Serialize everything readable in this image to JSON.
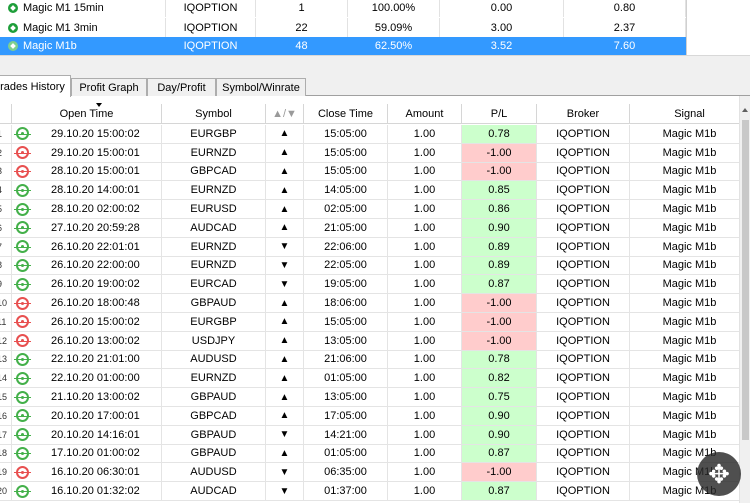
{
  "strategies": [
    {
      "name": "Magic M1 15min",
      "broker": "IQOPTION",
      "trades": "1",
      "winrate": "100.00%",
      "profit": "0.00",
      "extra": "0.80",
      "selected": false
    },
    {
      "name": "Magic M1 3min",
      "broker": "IQOPTION",
      "trades": "22",
      "winrate": "59.09%",
      "profit": "3.00",
      "extra": "2.37",
      "selected": false
    },
    {
      "name": "Magic M1b",
      "broker": "IQOPTION",
      "trades": "48",
      "winrate": "62.50%",
      "profit": "3.52",
      "extra": "7.60",
      "selected": true
    }
  ],
  "tabs": [
    "rades History",
    "Profit Graph",
    "Day/Profit",
    "Symbol/Winrate"
  ],
  "active_tab": 0,
  "columns": {
    "open_time": "Open Time",
    "symbol": "Symbol",
    "dir": "▲/▼",
    "close_time": "Close Time",
    "amount": "Amount",
    "pl": "P/L",
    "broker": "Broker",
    "signal": "Signal"
  },
  "colors": {
    "win": "#ccffcc",
    "loss": "#ffcccc",
    "selected_row": "#3399ff",
    "icon_win": "#44b04a",
    "icon_loss": "#e85050"
  },
  "trades": [
    {
      "idx": "1",
      "open_time": "29.10.20 15:00:02",
      "symbol": "EURGBP",
      "dir": "▲",
      "close_time": "15:05:00",
      "amount": "1.00",
      "pl": "0.78",
      "result": "win",
      "broker": "IQOPTION",
      "signal": "Magic M1b"
    },
    {
      "idx": "2",
      "open_time": "29.10.20 15:00:01",
      "symbol": "EURNZD",
      "dir": "▲",
      "close_time": "15:05:00",
      "amount": "1.00",
      "pl": "-1.00",
      "result": "loss",
      "broker": "IQOPTION",
      "signal": "Magic M1b"
    },
    {
      "idx": "3",
      "open_time": "28.10.20 15:00:01",
      "symbol": "GBPCAD",
      "dir": "▲",
      "close_time": "15:05:00",
      "amount": "1.00",
      "pl": "-1.00",
      "result": "loss",
      "broker": "IQOPTION",
      "signal": "Magic M1b"
    },
    {
      "idx": "4",
      "open_time": "28.10.20 14:00:01",
      "symbol": "EURNZD",
      "dir": "▲",
      "close_time": "14:05:00",
      "amount": "1.00",
      "pl": "0.85",
      "result": "win",
      "broker": "IQOPTION",
      "signal": "Magic M1b"
    },
    {
      "idx": "5",
      "open_time": "28.10.20 02:00:02",
      "symbol": "EURUSD",
      "dir": "▲",
      "close_time": "02:05:00",
      "amount": "1.00",
      "pl": "0.86",
      "result": "win",
      "broker": "IQOPTION",
      "signal": "Magic M1b"
    },
    {
      "idx": "6",
      "open_time": "27.10.20 20:59:28",
      "symbol": "AUDCAD",
      "dir": "▲",
      "close_time": "21:05:00",
      "amount": "1.00",
      "pl": "0.90",
      "result": "win",
      "broker": "IQOPTION",
      "signal": "Magic M1b"
    },
    {
      "idx": "7",
      "open_time": "26.10.20 22:01:01",
      "symbol": "EURNZD",
      "dir": "▼",
      "close_time": "22:06:00",
      "amount": "1.00",
      "pl": "0.89",
      "result": "win",
      "broker": "IQOPTION",
      "signal": "Magic M1b"
    },
    {
      "idx": "8",
      "open_time": "26.10.20 22:00:00",
      "symbol": "EURNZD",
      "dir": "▼",
      "close_time": "22:05:00",
      "amount": "1.00",
      "pl": "0.89",
      "result": "win",
      "broker": "IQOPTION",
      "signal": "Magic M1b"
    },
    {
      "idx": "9",
      "open_time": "26.10.20 19:00:02",
      "symbol": "EURCAD",
      "dir": "▼",
      "close_time": "19:05:00",
      "amount": "1.00",
      "pl": "0.87",
      "result": "win",
      "broker": "IQOPTION",
      "signal": "Magic M1b"
    },
    {
      "idx": "10",
      "open_time": "26.10.20 18:00:48",
      "symbol": "GBPAUD",
      "dir": "▲",
      "close_time": "18:06:00",
      "amount": "1.00",
      "pl": "-1.00",
      "result": "loss",
      "broker": "IQOPTION",
      "signal": "Magic M1b"
    },
    {
      "idx": "11",
      "open_time": "26.10.20 15:00:02",
      "symbol": "EURGBP",
      "dir": "▲",
      "close_time": "15:05:00",
      "amount": "1.00",
      "pl": "-1.00",
      "result": "loss",
      "broker": "IQOPTION",
      "signal": "Magic M1b"
    },
    {
      "idx": "12",
      "open_time": "26.10.20 13:00:02",
      "symbol": "USDJPY",
      "dir": "▲",
      "close_time": "13:05:00",
      "amount": "1.00",
      "pl": "-1.00",
      "result": "loss",
      "broker": "IQOPTION",
      "signal": "Magic M1b"
    },
    {
      "idx": "13",
      "open_time": "22.10.20 21:01:00",
      "symbol": "AUDUSD",
      "dir": "▲",
      "close_time": "21:06:00",
      "amount": "1.00",
      "pl": "0.78",
      "result": "win",
      "broker": "IQOPTION",
      "signal": "Magic M1b"
    },
    {
      "idx": "14",
      "open_time": "22.10.20 01:00:00",
      "symbol": "EURNZD",
      "dir": "▲",
      "close_time": "01:05:00",
      "amount": "1.00",
      "pl": "0.82",
      "result": "win",
      "broker": "IQOPTION",
      "signal": "Magic M1b"
    },
    {
      "idx": "15",
      "open_time": "21.10.20 13:00:02",
      "symbol": "GBPAUD",
      "dir": "▲",
      "close_time": "13:05:00",
      "amount": "1.00",
      "pl": "0.75",
      "result": "win",
      "broker": "IQOPTION",
      "signal": "Magic M1b"
    },
    {
      "idx": "16",
      "open_time": "20.10.20 17:00:01",
      "symbol": "GBPCAD",
      "dir": "▲",
      "close_time": "17:05:00",
      "amount": "1.00",
      "pl": "0.90",
      "result": "win",
      "broker": "IQOPTION",
      "signal": "Magic M1b"
    },
    {
      "idx": "17",
      "open_time": "20.10.20 14:16:01",
      "symbol": "GBPAUD",
      "dir": "▼",
      "close_time": "14:21:00",
      "amount": "1.00",
      "pl": "0.90",
      "result": "win",
      "broker": "IQOPTION",
      "signal": "Magic M1b"
    },
    {
      "idx": "18",
      "open_time": "17.10.20 01:00:02",
      "symbol": "GBPAUD",
      "dir": "▲",
      "close_time": "01:05:00",
      "amount": "1.00",
      "pl": "0.87",
      "result": "win",
      "broker": "IQOPTION",
      "signal": "Magic M1b"
    },
    {
      "idx": "19",
      "open_time": "16.10.20 06:30:01",
      "symbol": "AUDUSD",
      "dir": "▼",
      "close_time": "06:35:00",
      "amount": "1.00",
      "pl": "-1.00",
      "result": "loss",
      "broker": "IQOPTION",
      "signal": "Magic M1b"
    },
    {
      "idx": "20",
      "open_time": "16.10.20 01:32:02",
      "symbol": "AUDCAD",
      "dir": "▼",
      "close_time": "01:37:00",
      "amount": "1.00",
      "pl": "0.87",
      "result": "win",
      "broker": "IQOPTION",
      "signal": "Magic M1b"
    }
  ]
}
